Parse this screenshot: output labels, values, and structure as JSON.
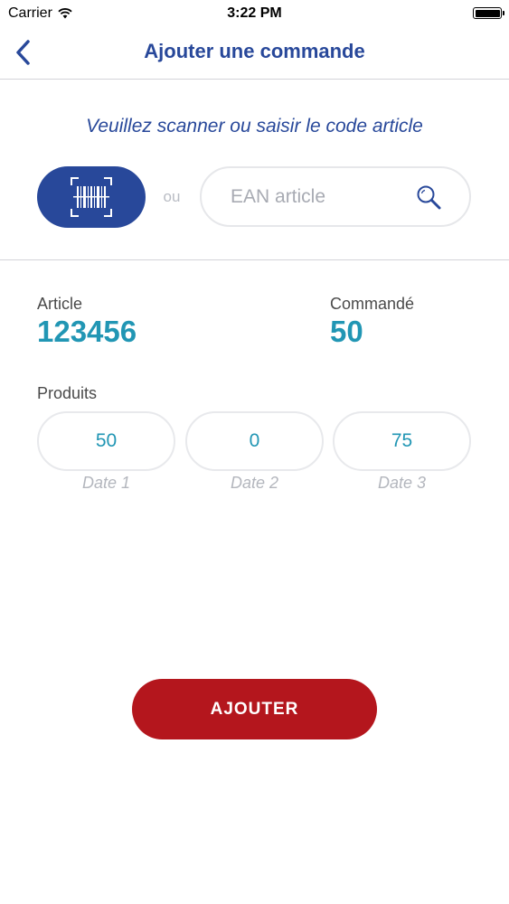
{
  "status_bar": {
    "carrier": "Carrier",
    "time": "3:22 PM",
    "icons": [
      "wifi-icon",
      "battery-icon"
    ]
  },
  "nav": {
    "title": "Ajouter une commande",
    "back_icon": "chevron-left-icon"
  },
  "scan": {
    "instruction": "Veuillez scanner ou saisir le code article",
    "scan_icon": "barcode-scan-icon",
    "or_label": "ou",
    "search_placeholder": "EAN article",
    "search_value": "",
    "search_icon": "search-icon"
  },
  "article": {
    "label": "Article",
    "value": "123456"
  },
  "ordered": {
    "label": "Commandé",
    "value": "50"
  },
  "products": {
    "label": "Produits",
    "items": [
      {
        "value": "50",
        "date_label": "Date 1"
      },
      {
        "value": "0",
        "date_label": "Date 2"
      },
      {
        "value": "75",
        "date_label": "Date 3"
      }
    ]
  },
  "actions": {
    "add_label": "AJOUTER"
  },
  "colors": {
    "primary_blue": "#28489a",
    "value_teal": "#2196b4",
    "add_red": "#b4161d",
    "border_grey": "#e6e7ea"
  }
}
